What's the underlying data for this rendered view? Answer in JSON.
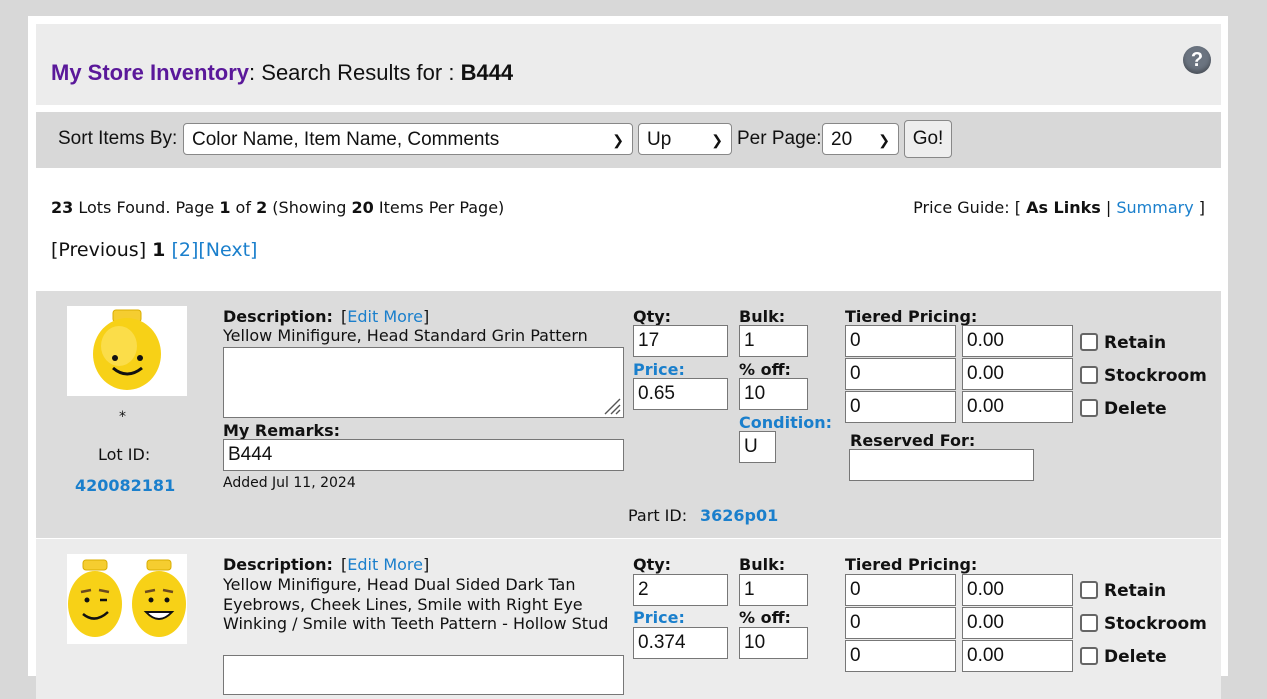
{
  "header": {
    "store_link": "My Store Inventory",
    "search_prefix": ": Search Results for : ",
    "search_term": "B444",
    "help_glyph": "?"
  },
  "sortbar": {
    "sort_label": "Sort Items By:",
    "sort_value": "Color Name, Item Name, Comments",
    "direction_value": "Up",
    "per_page_label": "Per Page:",
    "per_page_value": "20",
    "go_label": "Go!"
  },
  "summary": {
    "lots": "23",
    "lots_text": " Lots Found. Page ",
    "page": "1",
    "of_text": " of ",
    "pages": "2",
    "showing_text": " (Showing ",
    "per_page": "20",
    "items_text": " Items Per Page)"
  },
  "price_guide": {
    "label": "Price Guide: [ ",
    "as_links": "As Links",
    "sep": " | ",
    "summary": "Summary",
    "close": " ]"
  },
  "pagination": {
    "previous": "[Previous]",
    "current": "1",
    "page2": "[2]",
    "next": "[Next]"
  },
  "labels": {
    "description": "Description:",
    "edit_more": "[Edit More]",
    "edit_more_text": "Edit More",
    "qty": "Qty:",
    "bulk": "Bulk:",
    "tiered": "Tiered Pricing:",
    "price": "Price:",
    "pct_off": "% off:",
    "condition": "Condition:",
    "reserved_for": "Reserved For:",
    "my_remarks": "My Remarks:",
    "lot_id": "Lot ID:",
    "part_id": "Part ID:",
    "retain": "Retain",
    "stockroom": "Stockroom",
    "delete": "Delete"
  },
  "items": [
    {
      "description": "Yellow Minifigure, Head Standard Grin Pattern",
      "qty": "17",
      "bulk": "1",
      "price": "0.65",
      "pct_off": "10",
      "condition": "U",
      "tiers": [
        [
          "0",
          "0.00"
        ],
        [
          "0",
          "0.00"
        ],
        [
          "0",
          "0.00"
        ]
      ],
      "marker": "*",
      "lot_id": "420082181",
      "remarks": "B444",
      "added": "Added Jul 11, 2024",
      "part_id": "3626p01"
    },
    {
      "description": "Yellow Minifigure, Head Dual Sided Dark Tan Eyebrows, Cheek Lines, Smile with Right Eye Winking / Smile with Teeth Pattern - Hollow Stud",
      "qty": "2",
      "bulk": "1",
      "price": "0.374",
      "pct_off": "10",
      "tiers": [
        [
          "0",
          "0.00"
        ],
        [
          "0",
          "0.00"
        ],
        [
          "0",
          "0.00"
        ]
      ]
    }
  ]
}
